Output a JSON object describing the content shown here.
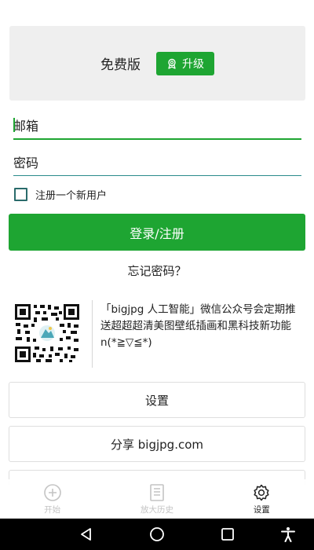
{
  "plan": {
    "label": "免费版",
    "upgrade_label": "升级"
  },
  "login": {
    "email_placeholder": "邮箱",
    "password_placeholder": "密码",
    "register_label": "注册一个新用户",
    "submit_label": "登录/注册",
    "forgot_label": "忘记密码？"
  },
  "promo": {
    "text": "「bigjpg 人工智能」微信公众号会定期推送超超超清美图壁纸插画和黑科技新功能 n(*≧▽≦*)"
  },
  "menu": {
    "settings_label": "设置",
    "share_label": "分享 bigjpg.com"
  },
  "tabs": [
    {
      "label": "开始",
      "icon": "plus-circle-icon",
      "active": false
    },
    {
      "label": "放大历史",
      "icon": "history-list-icon",
      "active": false
    },
    {
      "label": "设置",
      "icon": "gear-icon",
      "active": true
    }
  ],
  "colors": {
    "accent": "#1ea532",
    "checkbox_border": "#2a6b6b",
    "inactive_tab": "#c4c4c4"
  }
}
